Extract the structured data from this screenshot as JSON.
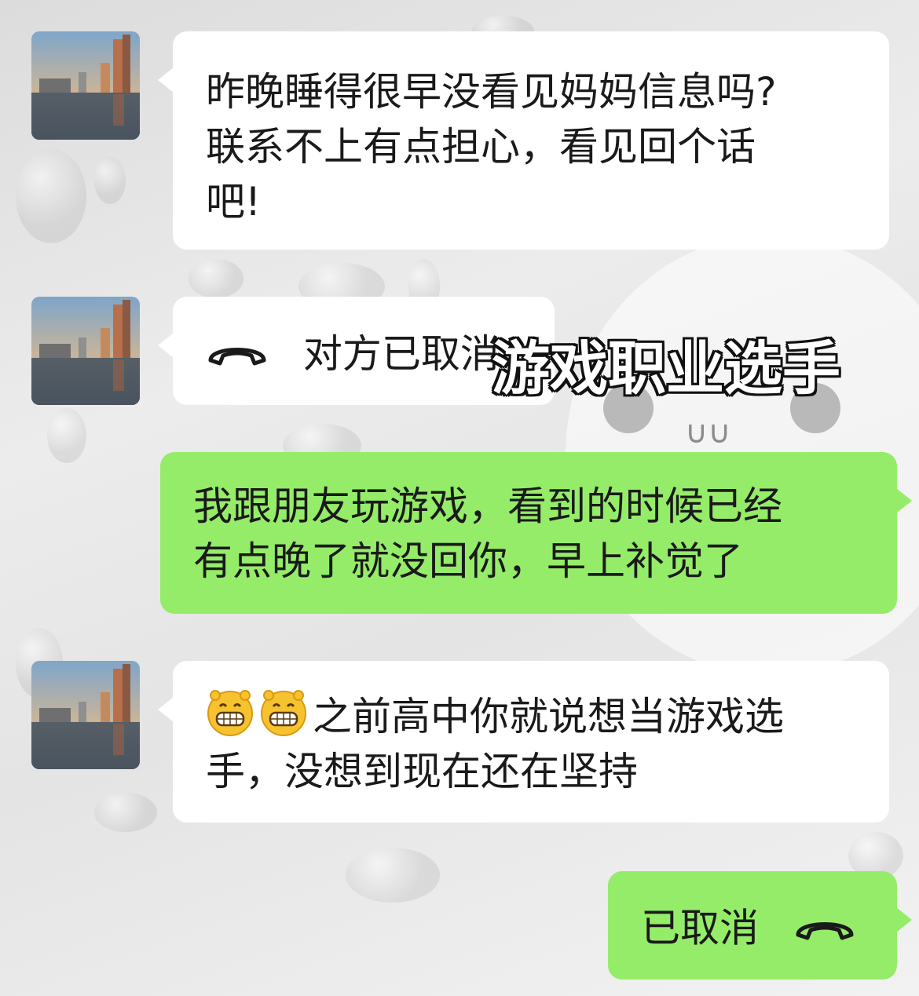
{
  "colors": {
    "incoming_bubble": "#ffffff",
    "outgoing_bubble": "#95ec69",
    "text": "#1a1a1a"
  },
  "messages": [
    {
      "side": "left",
      "lines": [
        "昨晚睡得很早没看见妈妈信息吗?",
        "联系不上有点担心，看见回个话",
        "吧!"
      ]
    },
    {
      "side": "left",
      "type": "call",
      "icon": "phone-hangup-icon",
      "text": "对方已取消"
    },
    {
      "side": "right",
      "lines": [
        "我跟朋友玩游戏，看到的时候已经",
        "有点晚了就没回你，早上补觉了"
      ]
    },
    {
      "side": "left",
      "emoji": [
        "grin-emoji",
        "grin-emoji"
      ],
      "lines": [
        "之前高中你就说想当游戏选",
        "手，没想到现在还在坚持"
      ]
    },
    {
      "side": "right",
      "type": "call",
      "icon": "phone-hangup-icon",
      "text": "已取消"
    }
  ],
  "overlay_caption": "游戏职业选手"
}
